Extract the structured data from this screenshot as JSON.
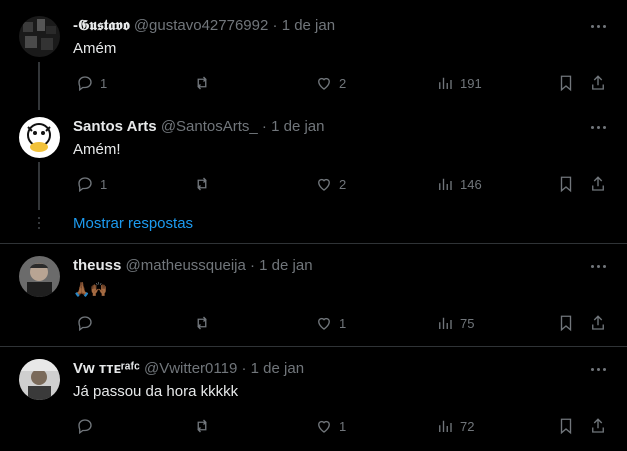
{
  "posts": [
    {
      "display_name": "-𝕲𝖚𝖘𝖙𝖆𝖛𝖔",
      "handle": "@gustavo42776992",
      "dot": "·",
      "date": "1 de jan",
      "text": "Amém",
      "replies": "1",
      "retweets": "",
      "likes": "2",
      "views": "191"
    },
    {
      "display_name": "Santos Arts",
      "handle": "@SantosArts_",
      "dot": "·",
      "date": "1 de jan",
      "text": "Amém!",
      "replies": "1",
      "retweets": "",
      "likes": "2",
      "views": "146"
    },
    {
      "display_name": "theuss",
      "handle": "@matheussqueija",
      "dot": "·",
      "date": "1 de jan",
      "text": "🙏🏾🙌🏾",
      "replies": "",
      "retweets": "",
      "likes": "1",
      "views": "75"
    },
    {
      "display_name": "Vw ᴛᴛᴇʳᵃᶠᶜ",
      "handle": "@Vwitter0119",
      "dot": "·",
      "date": "1 de jan",
      "text": "Já passou da hora kkkkk",
      "replies": "",
      "retweets": "",
      "likes": "1",
      "views": "72"
    }
  ],
  "show_replies_label": "Mostrar respostas",
  "colors": {
    "background": "#000000",
    "text": "#e7e9ea",
    "muted": "#71767b",
    "link": "#1d9bf0",
    "divider": "#2f3336"
  }
}
